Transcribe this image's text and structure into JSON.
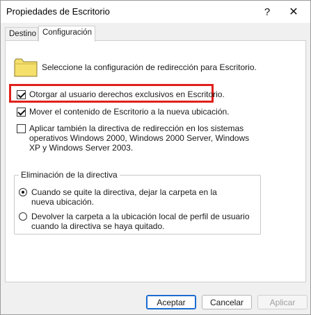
{
  "window": {
    "title": "Propiedades de Escritorio",
    "help_glyph": "?",
    "close_glyph": "✕"
  },
  "tabs": [
    {
      "label": "Destino",
      "selected": false
    },
    {
      "label": "Configuración",
      "selected": true
    }
  ],
  "panel": {
    "header_text": "Seleccione la configuración de redirección para Escritorio.",
    "folder_icon": "folder-icon",
    "options": [
      {
        "label": "Otorgar al usuario derechos exclusivos en Escritorio.",
        "checked": true,
        "highlighted": true
      },
      {
        "label": "Mover el contenido de Escritorio a la nueva ubicación.",
        "checked": true
      },
      {
        "label": "Aplicar también la directiva de redirección en los sistemas operativos Windows 2000, Windows 2000 Server, Windows XP y Windows Server 2003.",
        "checked": false
      }
    ],
    "policy_group": {
      "legend": "Eliminación de la directiva",
      "radios": [
        {
          "label": "Cuando se quite la directiva, dejar la carpeta en la nueva ubicación.",
          "selected": true
        },
        {
          "label": "Devolver la carpeta a la ubicación local de perfil de usuario cuando la directiva se haya quitado.",
          "selected": false
        }
      ]
    }
  },
  "buttons": {
    "ok": "Aceptar",
    "cancel": "Cancelar",
    "apply": "Aplicar"
  },
  "colors": {
    "highlight": "#e0201b",
    "folder_fill": "#f5e06b",
    "accent": "#1a6bd0"
  }
}
